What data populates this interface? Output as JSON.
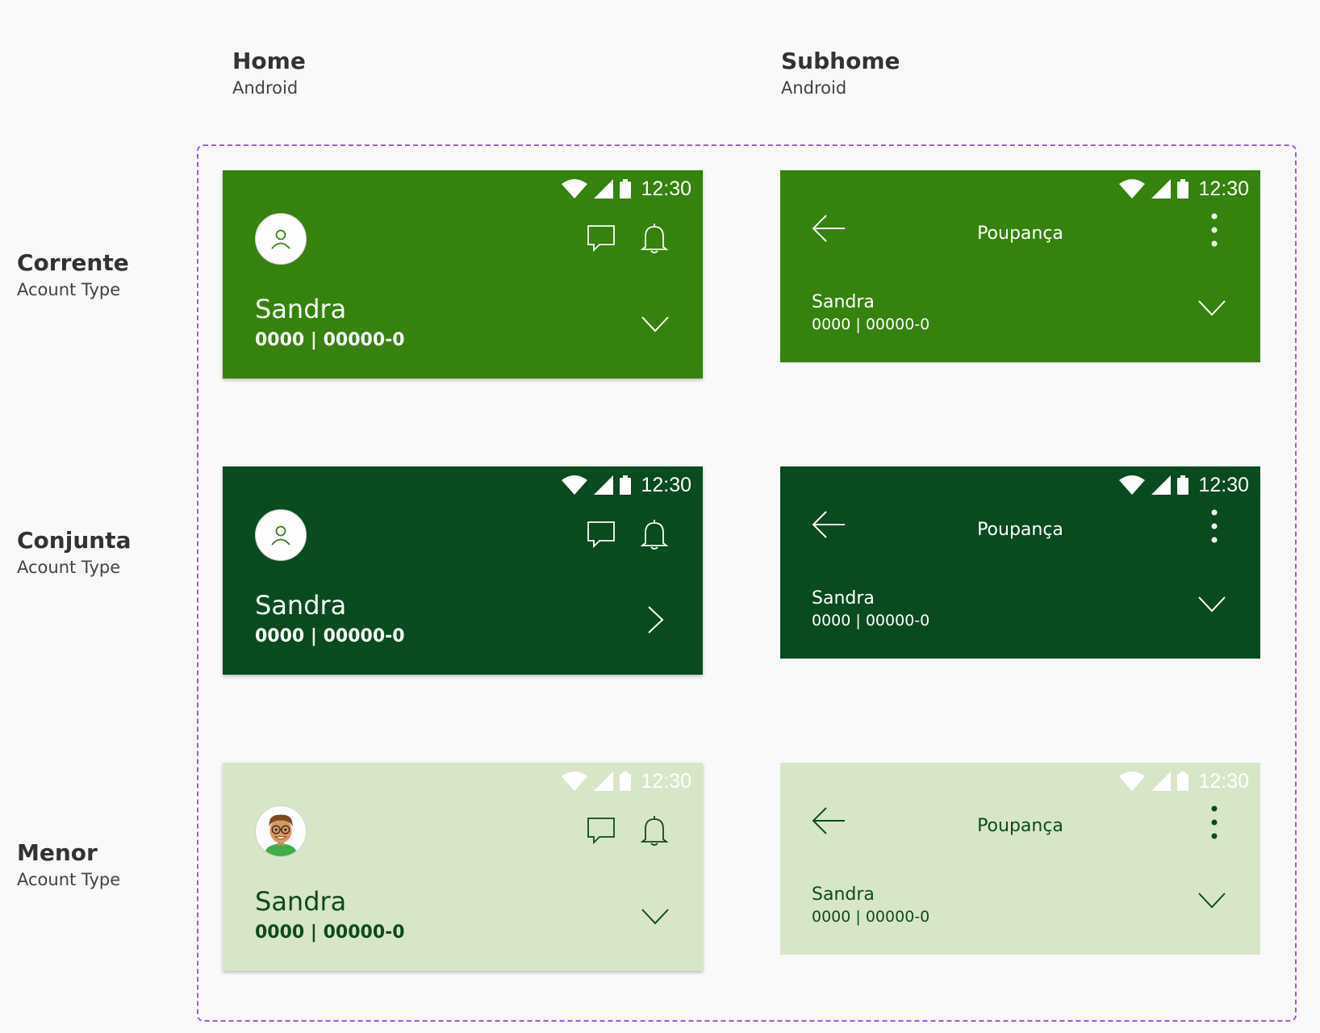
{
  "columns": [
    {
      "title": "Home",
      "subtitle": "Android"
    },
    {
      "title": "Subhome",
      "subtitle": "Android"
    }
  ],
  "rows": [
    {
      "title": "Corrente",
      "subtitle": "Acount Type"
    },
    {
      "title": "Conjunta",
      "subtitle": "Acount Type"
    },
    {
      "title": "Menor",
      "subtitle": "Acount Type"
    }
  ],
  "status_time": "12:30",
  "home": {
    "name": "Sandra",
    "account": "0000 | 00000-0"
  },
  "subhome": {
    "title": "Poupança",
    "name": "Sandra",
    "account": "0000 | 00000-0"
  },
  "colors": {
    "corrente": "#35820e",
    "conjunta": "#0a4a1f",
    "menor": "#d8e6c8",
    "frame": "#a855e8"
  }
}
